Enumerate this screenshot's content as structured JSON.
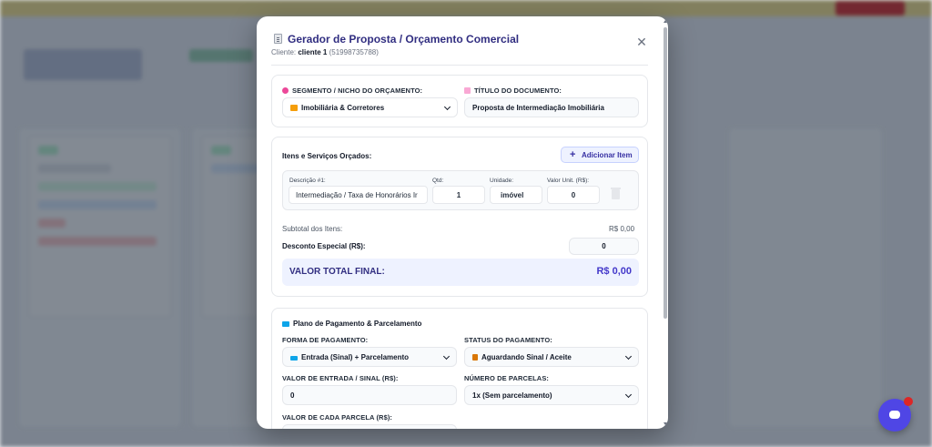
{
  "modal": {
    "title": "Gerador de Proposta / Orçamento Comercial",
    "client_label": "Cliente:",
    "client_name": "cliente 1",
    "client_phone": "(51998735788)",
    "close_symbol": "✕"
  },
  "segment": {
    "segment_label": "SEGMENTO / NICHO DO ORÇAMENTO:",
    "segment_value": "Imobiliária & Corretores",
    "title_label": "TÍTULO DO DOCUMENTO:",
    "title_value": "Proposta de Intermediação Imobiliária"
  },
  "items": {
    "section_title": "Itens e Serviços Orçados:",
    "add_button": "Adicionar Item",
    "add_symbol": "+",
    "desc_label": "Descrição #1:",
    "qty_label": "Qtd:",
    "unit_label": "Unidade:",
    "price_label": "Valor Unit. (R$):",
    "desc_value": "Intermediação / Taxa de Honorários Ir",
    "qty_value": "1",
    "unit_value": "imóvel",
    "price_value": "0",
    "subtotal_label": "Subtotal dos Itens:",
    "subtotal_value": "R$ 0,00",
    "discount_label": "Desconto Especial (R$):",
    "discount_value": "0",
    "total_label": "VALOR TOTAL FINAL:",
    "total_value": "R$ 0,00"
  },
  "payment": {
    "section_title": "Plano de Pagamento & Parcelamento",
    "form_label": "FORMA DE PAGAMENTO:",
    "form_value": "Entrada (Sinal) + Parcelamento",
    "status_label": "STATUS DO PAGAMENTO:",
    "status_value": "Aguardando Sinal / Aceite",
    "entry_label": "VALOR DE ENTRADA / SINAL (R$):",
    "entry_value": "0",
    "installments_label": "NÚMERO DE PARCELAS:",
    "installments_value": "1x (Sem parcelamento)",
    "installment_value_label": "VALOR DE CADA PARCELA (R$):"
  },
  "colors": {
    "accent": "#4338ca",
    "title": "#312e81",
    "overlay": "#1e293b"
  }
}
